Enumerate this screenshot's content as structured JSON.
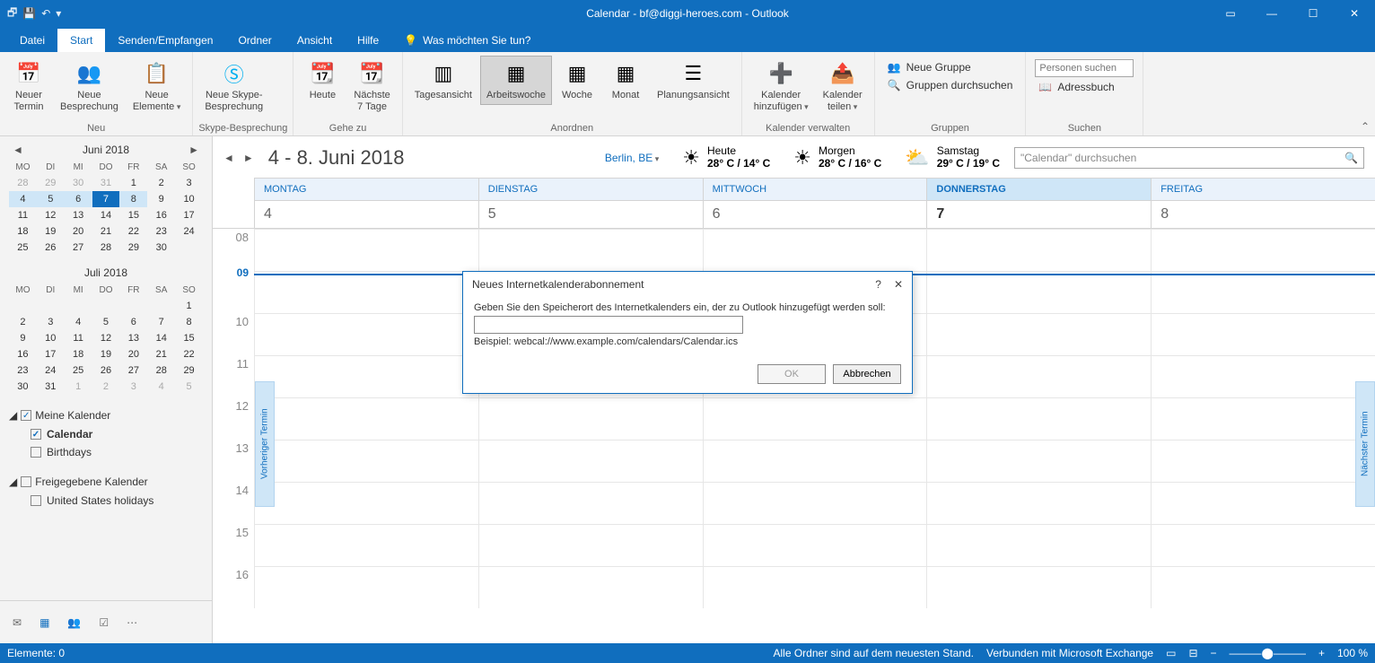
{
  "title": "Calendar - bf@diggi-heroes.com - Outlook",
  "tabs": {
    "file": "Datei",
    "start": "Start",
    "send": "Senden/Empfangen",
    "folder": "Ordner",
    "view": "Ansicht",
    "help": "Hilfe",
    "tell": "Was möchten Sie tun?"
  },
  "ribbon": {
    "new_appt": "Neuer\nTermin",
    "new_meet": "Neue\nBesprechung",
    "new_items": "Neue\nElemente",
    "skype": "Neue Skype-\nBesprechung",
    "today": "Heute",
    "next7": "Nächste\n7 Tage",
    "dayview": "Tagesansicht",
    "workweek": "Arbeitswoche",
    "week": "Woche",
    "month": "Monat",
    "schedule": "Planungsansicht",
    "addcal": "Kalender\nhinzufügen",
    "sharecal": "Kalender\nteilen",
    "newgroup": "Neue Gruppe",
    "browsegroups": "Gruppen durchsuchen",
    "searchppl": "Personen suchen",
    "addrbook": "Adressbuch",
    "groups": {
      "new": "Neu",
      "skype": "Skype-Besprechung",
      "goto": "Gehe zu",
      "arrange": "Anordnen",
      "manage": "Kalender verwalten",
      "groups": "Gruppen",
      "search": "Suchen"
    }
  },
  "mini": {
    "jun": "Juni 2018",
    "jul": "Juli 2018",
    "dow": [
      "MO",
      "DI",
      "MI",
      "DO",
      "FR",
      "SA",
      "SO"
    ],
    "jun_rows": [
      [
        "28",
        "29",
        "30",
        "31",
        "1",
        "2",
        "3"
      ],
      [
        "4",
        "5",
        "6",
        "7",
        "8",
        "9",
        "10"
      ],
      [
        "11",
        "12",
        "13",
        "14",
        "15",
        "16",
        "17"
      ],
      [
        "18",
        "19",
        "20",
        "21",
        "22",
        "23",
        "24"
      ],
      [
        "25",
        "26",
        "27",
        "28",
        "29",
        "30",
        ""
      ]
    ],
    "jul_rows": [
      [
        "",
        "",
        "",
        "",
        "",
        "",
        "1"
      ],
      [
        "2",
        "3",
        "4",
        "5",
        "6",
        "7",
        "8"
      ],
      [
        "9",
        "10",
        "11",
        "12",
        "13",
        "14",
        "15"
      ],
      [
        "16",
        "17",
        "18",
        "19",
        "20",
        "21",
        "22"
      ],
      [
        "23",
        "24",
        "25",
        "26",
        "27",
        "28",
        "29"
      ],
      [
        "30",
        "31",
        "1",
        "2",
        "3",
        "4",
        "5"
      ]
    ]
  },
  "tree": {
    "mycals": "Meine Kalender",
    "cal": "Calendar",
    "bday": "Birthdays",
    "shared": "Freigegebene Kalender",
    "us": "United States holidays"
  },
  "hdr": {
    "range": "4 - 8. Juni 2018",
    "city": "Berlin, BE",
    "search_ph": "\"Calendar\" durchsuchen"
  },
  "weather": [
    {
      "d": "Heute",
      "t": "28° C / 14° C"
    },
    {
      "d": "Morgen",
      "t": "28° C / 16° C"
    },
    {
      "d": "Samstag",
      "t": "29° C / 19° C"
    }
  ],
  "days": {
    "names": [
      "MONTAG",
      "DIENSTAG",
      "MITTWOCH",
      "DONNERSTAG",
      "FREITAG"
    ],
    "nums": [
      "4",
      "5",
      "6",
      "7",
      "8"
    ]
  },
  "hours": [
    "08",
    "09",
    "10",
    "11",
    "12",
    "13",
    "14",
    "15",
    "16"
  ],
  "sidetabs": {
    "prev": "Vorheriger Termin",
    "next": "Nächster Termin"
  },
  "dialog": {
    "title": "Neues Internetkalenderabonnement",
    "prompt": "Geben Sie den Speicherort des Internetkalenders ein, der zu Outlook hinzugefügt werden soll:",
    "example": "Beispiel: webcal://www.example.com/calendars/Calendar.ics",
    "ok": "OK",
    "cancel": "Abbrechen"
  },
  "status": {
    "items": "Elemente: 0",
    "sync": "Alle Ordner sind auf dem neuesten Stand.",
    "conn": "Verbunden mit Microsoft Exchange",
    "zoom": "100 %"
  }
}
